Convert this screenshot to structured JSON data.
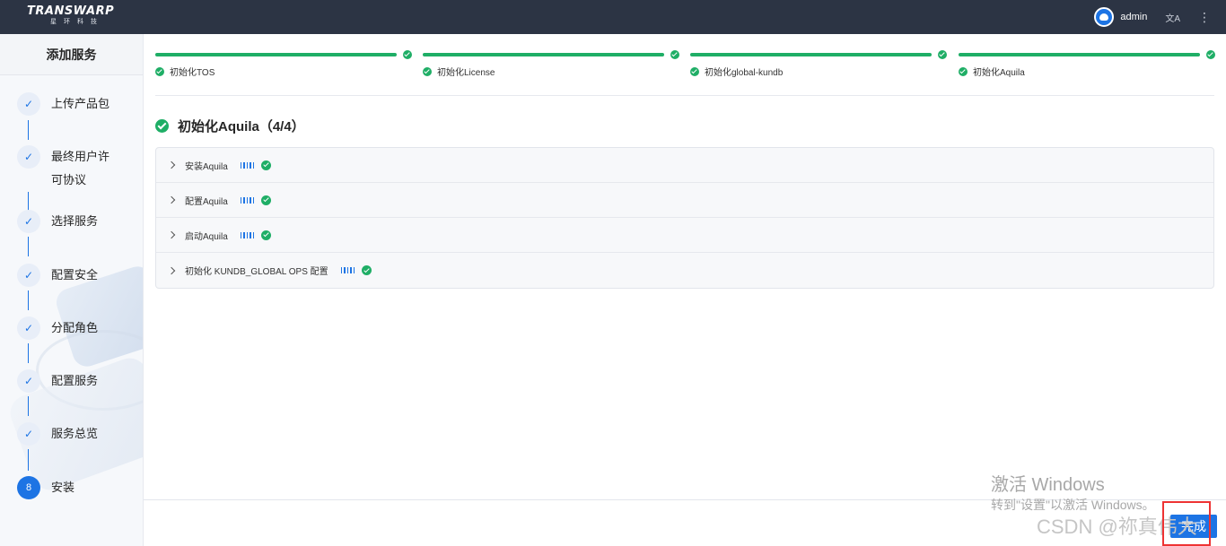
{
  "topbar": {
    "logo_main": "TRANSWARP",
    "logo_sub": "星环科技",
    "username": "admin",
    "lang_icon": "文A",
    "more_icon": "⋮"
  },
  "sidebar": {
    "title": "添加服务",
    "steps": [
      {
        "label": "上传产品包",
        "status": "done"
      },
      {
        "label": "最终用户许",
        "label2": "可协议",
        "status": "done"
      },
      {
        "label": "选择服务",
        "status": "done"
      },
      {
        "label": "配置安全",
        "status": "done"
      },
      {
        "label": "分配角色",
        "status": "done"
      },
      {
        "label": "配置服务",
        "status": "done"
      },
      {
        "label": "服务总览",
        "status": "done"
      },
      {
        "label": "安装",
        "number": "8",
        "status": "active"
      }
    ],
    "check_glyph": "✓"
  },
  "progress": [
    {
      "label": "初始化TOS",
      "percent": 100
    },
    {
      "label": "初始化License",
      "percent": 100
    },
    {
      "label": "初始化global-kundb",
      "percent": 100
    },
    {
      "label": "初始化Aquila",
      "percent": 100
    }
  ],
  "section": {
    "title": "初始化Aquila（4/4）"
  },
  "tasks": [
    {
      "label": "安装Aquila",
      "status": "success"
    },
    {
      "label": "配置Aquila",
      "status": "success"
    },
    {
      "label": "启动Aquila",
      "status": "success"
    },
    {
      "label": "初始化 KUNDB_GLOBAL OPS 配置",
      "status": "success"
    }
  ],
  "footer": {
    "done_label": "完成"
  },
  "overlay": {
    "watermark_line1": "激活 Windows",
    "watermark_line2": "转到\"设置\"以激活 Windows。",
    "csdn": "CSDN @祢真伟大"
  },
  "colors": {
    "topbar": "#2c3444",
    "accent": "#1d74e4",
    "success": "#1fae66"
  }
}
